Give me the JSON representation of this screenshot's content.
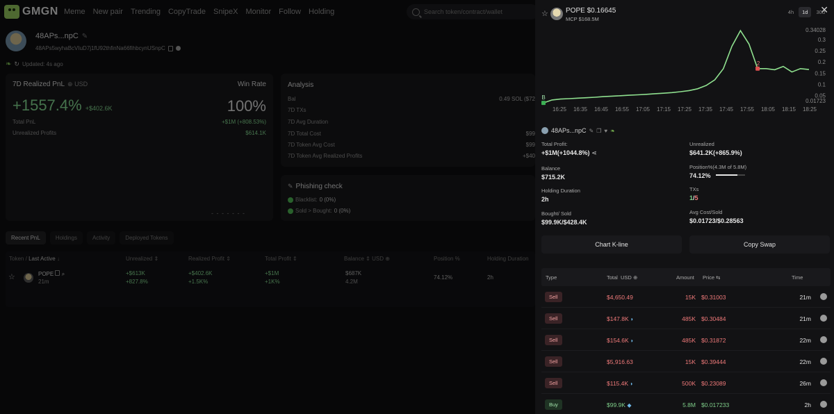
{
  "nav": {
    "logo_text": "GMGN",
    "items": [
      "Meme",
      "New pair",
      "Trending",
      "CopyTrade",
      "SnipeX",
      "Monitor",
      "Follow",
      "Holding"
    ],
    "search_placeholder": "Search token/contract/wallet"
  },
  "wallet": {
    "name": "48APs...npC",
    "address": "48APs5wyhaBcVIuD7j1fU92thfinNa66fihbcynUSnpC",
    "updated": "Updated: 4s ago"
  },
  "pnl_card": {
    "title": "7D Realized PnL",
    "currency": "USD",
    "win_rate_label": "Win Rate",
    "pnl_pct": "+1557.4%",
    "pnl_usd": "+$402.6K",
    "win_rate": "100%",
    "total_pnl_label": "Total PnL",
    "total_pnl_value": "+$1M (+808.53%)",
    "unrealized_label": "Unrealized Profits",
    "unrealized_value": "$614.1K",
    "dashes": "- - - - - - -"
  },
  "analysis": {
    "title": "Analysis",
    "rows": [
      {
        "label": "Bal",
        "value": "0.49 SOL ($72"
      },
      {
        "label": "7D TXs",
        "value": ""
      },
      {
        "label": "7D Avg Duration",
        "value": ""
      },
      {
        "label": "7D Total Cost",
        "value": "$99"
      },
      {
        "label": "7D Token Avg Cost",
        "value": "$99"
      },
      {
        "label": "7D Token Avg Realized Profits",
        "value": "+$40"
      }
    ]
  },
  "phishing": {
    "title": "Phishing check",
    "blacklist_label": "Blacklist:",
    "blacklist_value": "0 (0%)",
    "sold_label": "Sold > Bought:",
    "sold_value": "0 (0%)"
  },
  "tabs": [
    "Recent PnL",
    "Holdings",
    "Activity",
    "Deployed Tokens"
  ],
  "table": {
    "headers": {
      "token": "Token",
      "sep": "/",
      "last_active": "Last Active",
      "unrealized": "Unrealized",
      "realized": "Realized Profit",
      "total": "Total Profit",
      "balance": "Balance",
      "balance_unit": "USD",
      "position": "Position %",
      "holding": "Holding Duration"
    },
    "row": {
      "token": "POPE",
      "last_active": "21m",
      "unrealized": "+$613K",
      "unrealized_pct": "+827.8%",
      "realized": "+$402.6K",
      "realized_pct": "+1.5K%",
      "total": "+$1M",
      "total_pct": "+1K%",
      "balance": "$687K",
      "balance_amt": "4.2M",
      "position": "74.12%",
      "holding": "2h"
    }
  },
  "panel": {
    "token_title": "POPE $0.16645",
    "mcp": "MCP $168.5M",
    "ranges": [
      "4h",
      "1d",
      "30d"
    ],
    "active_range": "1d",
    "wallet_name": "48APs...npC",
    "total_profit_label": "Total Profit:",
    "total_profit_value": "+$1M(+1044.8%)",
    "unrealized_label": "Unrealized",
    "unrealized_value": "$641.2K(+865.9%)",
    "balance_label": "Balance",
    "balance_value": "$715.2K",
    "position_label": "Position%(4.3M of 5.8M)",
    "position_value": "74.12%",
    "position_fraction": 0.7412,
    "holding_label": "Holding Duration",
    "holding_value": "2h",
    "txs_label": "TXs",
    "txs_buy": "1",
    "txs_sep": "/",
    "txs_sell": "5",
    "bought_label": "Bought/ Sold",
    "bought_value": "$99.9K/$428.4K",
    "avg_label": "Avg Cost/Sold",
    "avg_value": "$0.01723/$0.28563",
    "btn_kline": "Chart K-line",
    "btn_copy": "Copy Swap",
    "tx_headers": {
      "type": "Type",
      "total": "Total",
      "total_unit": "USD",
      "amount": "Amount",
      "price": "Price",
      "time": "Time"
    },
    "txs": [
      {
        "type": "Sell",
        "total": "$4,650.49",
        "whale": false,
        "amount": "15K",
        "price": "$0.31003",
        "time": "21m"
      },
      {
        "type": "Sell",
        "total": "$147.8K",
        "whale": true,
        "amount": "485K",
        "price": "$0.30484",
        "time": "21m"
      },
      {
        "type": "Sell",
        "total": "$154.6K",
        "whale": true,
        "amount": "485K",
        "price": "$0.31872",
        "time": "22m"
      },
      {
        "type": "Sell",
        "total": "$5,916.63",
        "whale": false,
        "amount": "15K",
        "price": "$0.39444",
        "time": "22m"
      },
      {
        "type": "Sell",
        "total": "$115.4K",
        "whale": true,
        "amount": "500K",
        "price": "$0.23089",
        "time": "26m"
      },
      {
        "type": "Buy",
        "total": "$99.9K",
        "whale": true,
        "amount": "5.8M",
        "price": "$0.017233",
        "time": "2h"
      }
    ]
  },
  "chart_data": {
    "type": "line",
    "x_ticks": [
      "16:25",
      "16:35",
      "16:45",
      "16:55",
      "17:05",
      "17:15",
      "17:25",
      "17:35",
      "17:45",
      "17:55",
      "18:05",
      "18:15",
      "18:25"
    ],
    "y_ticks": [
      "0.34028",
      "0.3",
      "0.25",
      "0.2",
      "0.15",
      "0.1",
      "0.05",
      "0.01723"
    ],
    "ylim": [
      0.01723,
      0.34028
    ],
    "series": [
      {
        "values": [
          0.017,
          0.03,
          0.034,
          0.036,
          0.038,
          0.04,
          0.042,
          0.045,
          0.047,
          0.049,
          0.051,
          0.053,
          0.055,
          0.058,
          0.06,
          0.063,
          0.067,
          0.072,
          0.08,
          0.095,
          0.12,
          0.17,
          0.27,
          0.34,
          0.28,
          0.17,
          0.17,
          0.165,
          0.18,
          0.155,
          0.17,
          0.166
        ]
      }
    ],
    "markers": [
      {
        "label": "B",
        "index": 0
      },
      {
        "label": "2",
        "index": 25
      }
    ],
    "color": "#8fe08f"
  }
}
